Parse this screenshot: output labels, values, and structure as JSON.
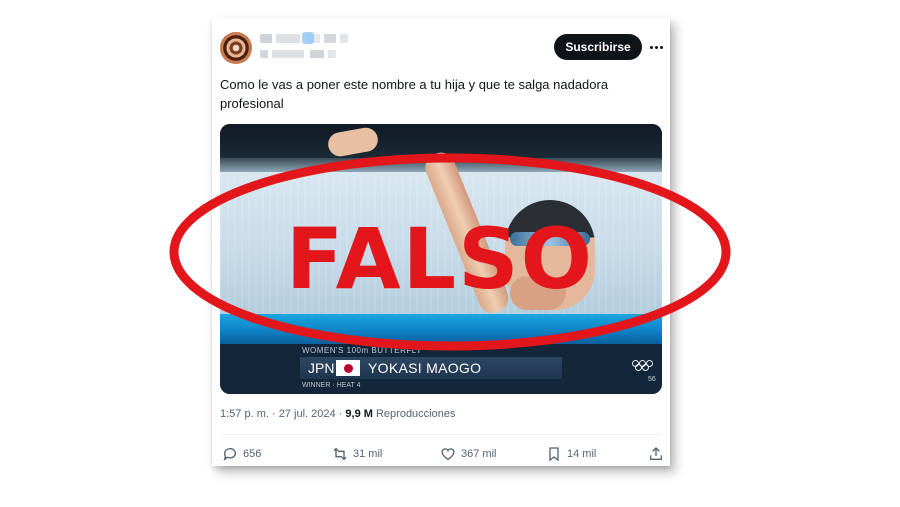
{
  "tweet": {
    "subscribe_label": "Suscribirse",
    "text": "Como le vas a poner este nombre a tu hija y que te salga nadadora profesional",
    "time": "1:57 p. m.",
    "separator": "·",
    "date": "27 jul. 2024",
    "views_count": "9,9 M",
    "views_label": "Reproducciones"
  },
  "media": {
    "caption_top": "WOMEN'S 100m BUTTERFLY",
    "country": "JPN",
    "swimmer_name": "YOKASI MAOGO",
    "caption_bottom": "WINNER · HEAT 4",
    "lane_number": "56"
  },
  "overlay": {
    "stamp_text": "FALSO",
    "stamp_color": "#e3161b"
  },
  "actions": {
    "replies": "656",
    "reposts": "31 mil",
    "likes": "367 mil",
    "bookmarks": "14 mil"
  },
  "icons": {
    "more": "more-dots-icon",
    "reply": "reply-bubble-icon",
    "repost": "repost-arrows-icon",
    "like": "heart-icon",
    "bookmark": "bookmark-icon",
    "share": "share-upload-icon",
    "flag": "japan-flag-icon",
    "rings": "olympic-rings-icon"
  }
}
